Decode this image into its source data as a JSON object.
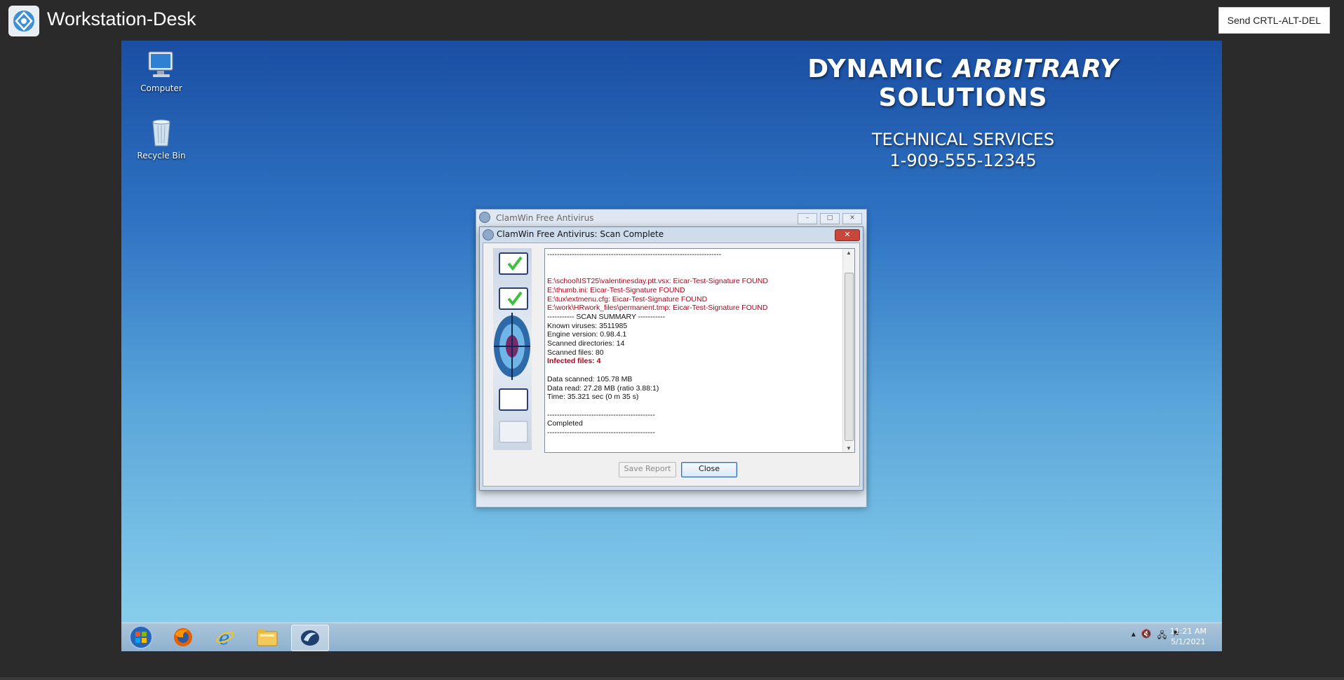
{
  "appbar": {
    "title": "Workstation-Desk",
    "cad_button": "Send CRTL-ALT-DEL"
  },
  "desktop": {
    "icons": [
      {
        "label": "Computer",
        "icon": "computer-icon"
      },
      {
        "label": "Recycle Bin",
        "icon": "recycle-bin-icon"
      }
    ],
    "brand": {
      "line1_a": "DYNAMIC ",
      "line1_b": "ARBITRARY",
      "line1_c": " SOLUTIONS",
      "line2": "TECHNICAL SERVICES",
      "line3": "1-909-555-12345"
    }
  },
  "bg_window": {
    "title": "ClamWin Free Antivirus"
  },
  "dialog": {
    "title": "ClamWin Free Antivirus: Scan Complete",
    "log": [
      {
        "text": "-----------------------------------------------------------------------",
        "style": "normal"
      },
      {
        "text": "",
        "style": "normal"
      },
      {
        "text": "",
        "style": "normal"
      },
      {
        "text": "E:\\school\\IST25\\valentinesday.ptt.vsx: Eicar-Test-Signature FOUND",
        "style": "red"
      },
      {
        "text": "E:\\thumb.ini: Eicar-Test-Signature FOUND",
        "style": "red"
      },
      {
        "text": "E:\\tux\\extmenu.cfg: Eicar-Test-Signature FOUND",
        "style": "red"
      },
      {
        "text": "E:\\work\\HRwork_files\\permanent.tmp: Eicar-Test-Signature FOUND",
        "style": "red"
      },
      {
        "text": "----------- SCAN SUMMARY -----------",
        "style": "normal"
      },
      {
        "text": "Known viruses: 3511985",
        "style": "normal"
      },
      {
        "text": "Engine version: 0.98.4.1",
        "style": "normal"
      },
      {
        "text": "Scanned directories: 14",
        "style": "normal"
      },
      {
        "text": "Scanned files: 80",
        "style": "normal"
      },
      {
        "text": "Infected files: 4",
        "style": "redb"
      },
      {
        "text": "",
        "style": "normal"
      },
      {
        "text": "Data scanned: 105.78 MB",
        "style": "normal"
      },
      {
        "text": "Data read: 27.28 MB (ratio 3.88:1)",
        "style": "normal"
      },
      {
        "text": "Time: 35.321 sec (0 m 35 s)",
        "style": "normal"
      },
      {
        "text": "",
        "style": "normal"
      },
      {
        "text": "--------------------------------------------",
        "style": "normal"
      },
      {
        "text": "Completed",
        "style": "normal"
      },
      {
        "text": "--------------------------------------------",
        "style": "normal"
      }
    ],
    "save_button": "Save Report",
    "close_button": "Close"
  },
  "taskbar": {
    "apps": [
      "start-orb-icon",
      "firefox-icon",
      "internet-explorer-icon",
      "file-explorer-icon",
      "clamwin-icon"
    ],
    "clock_time": "11:21 AM",
    "clock_date": "5/1/2021"
  }
}
